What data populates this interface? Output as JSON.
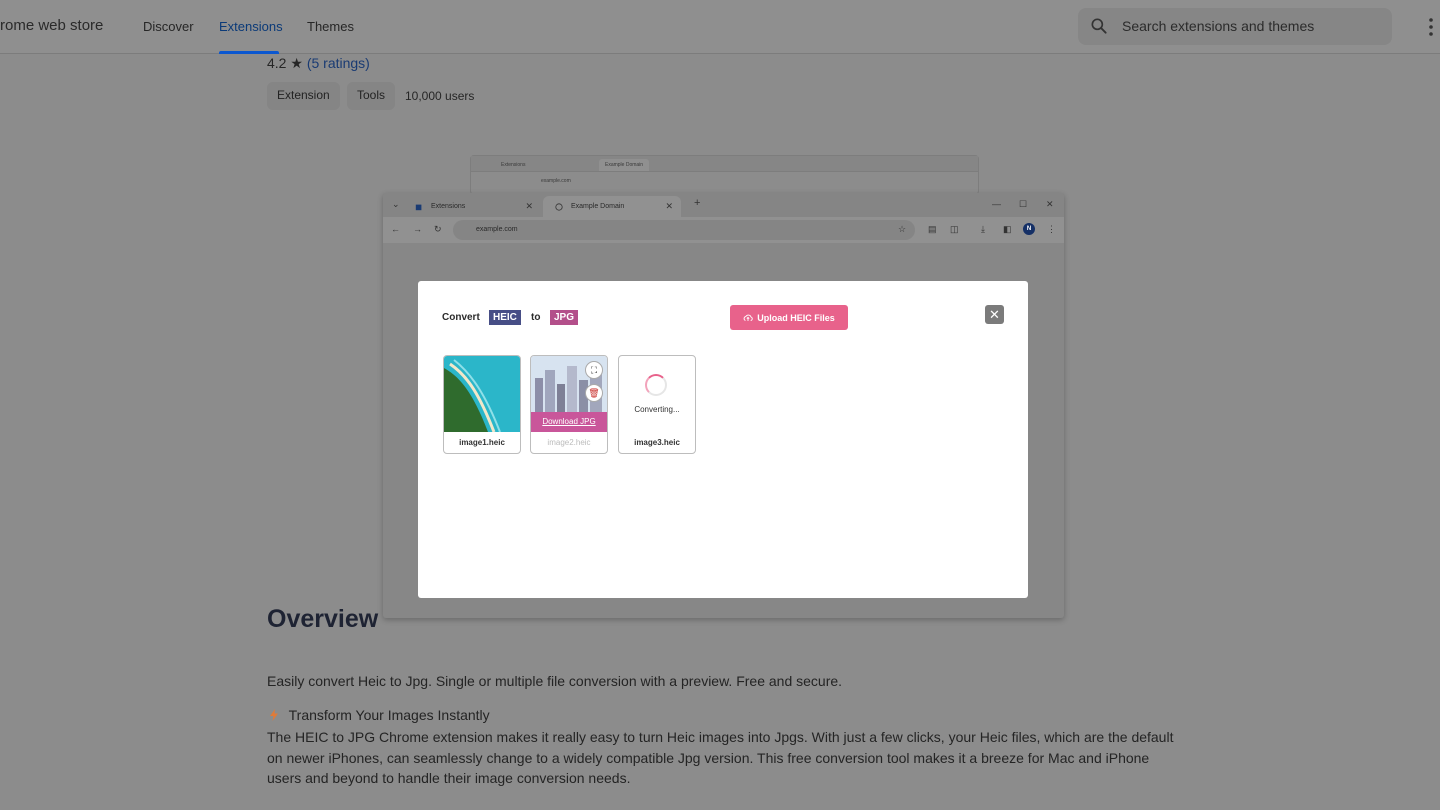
{
  "header": {
    "brand": "rome web store",
    "nav": [
      "Discover",
      "Extensions",
      "Themes"
    ],
    "active_nav": "Extensions",
    "search_placeholder": "Search extensions and themes"
  },
  "listing": {
    "rating_value": "4.2",
    "ratings_link": "(5 ratings)",
    "tags": [
      "Extension",
      "Tools"
    ],
    "users": "10,000 users"
  },
  "screenshot": {
    "back_window": {
      "tabs": [
        "Extensions",
        "Example Domain"
      ],
      "url": "example.com"
    },
    "tabs": [
      "Extensions",
      "Example Domain"
    ],
    "url": "example.com",
    "profile_initial": "N",
    "modal": {
      "convert_label": "Convert",
      "from_format": "HEIC",
      "to_label": "to",
      "to_format": "JPG",
      "upload_label": "Upload HEIC Files",
      "close_symbol": "✕",
      "cards": [
        {
          "name": "image1.heic"
        },
        {
          "name": "image2.heic",
          "action": "Download JPG"
        },
        {
          "name": "image3.heic",
          "status": "Converting..."
        }
      ]
    }
  },
  "overview": {
    "heading": "Overview",
    "summary": "Easily convert Heic to Jpg. Single or multiple file conversion with a preview. Free and secure.",
    "feature_icon": "lightning-icon",
    "feature_title": "Transform Your Images Instantly",
    "body": "The HEIC to JPG Chrome extension makes it really easy to turn Heic images into Jpgs. With just a few clicks, your Heic files, which are the default on newer iPhones, can seamlessly change to a widely compatible Jpg version. This free conversion tool makes it a breeze for Mac and iPhone users and beyond to handle their image conversion needs."
  },
  "colors": {
    "heic_badge": "#474e86",
    "jpg_badge": "#b34f8a",
    "upload_button": "#e8628b",
    "active_nav_underline": "#0b57d0"
  }
}
